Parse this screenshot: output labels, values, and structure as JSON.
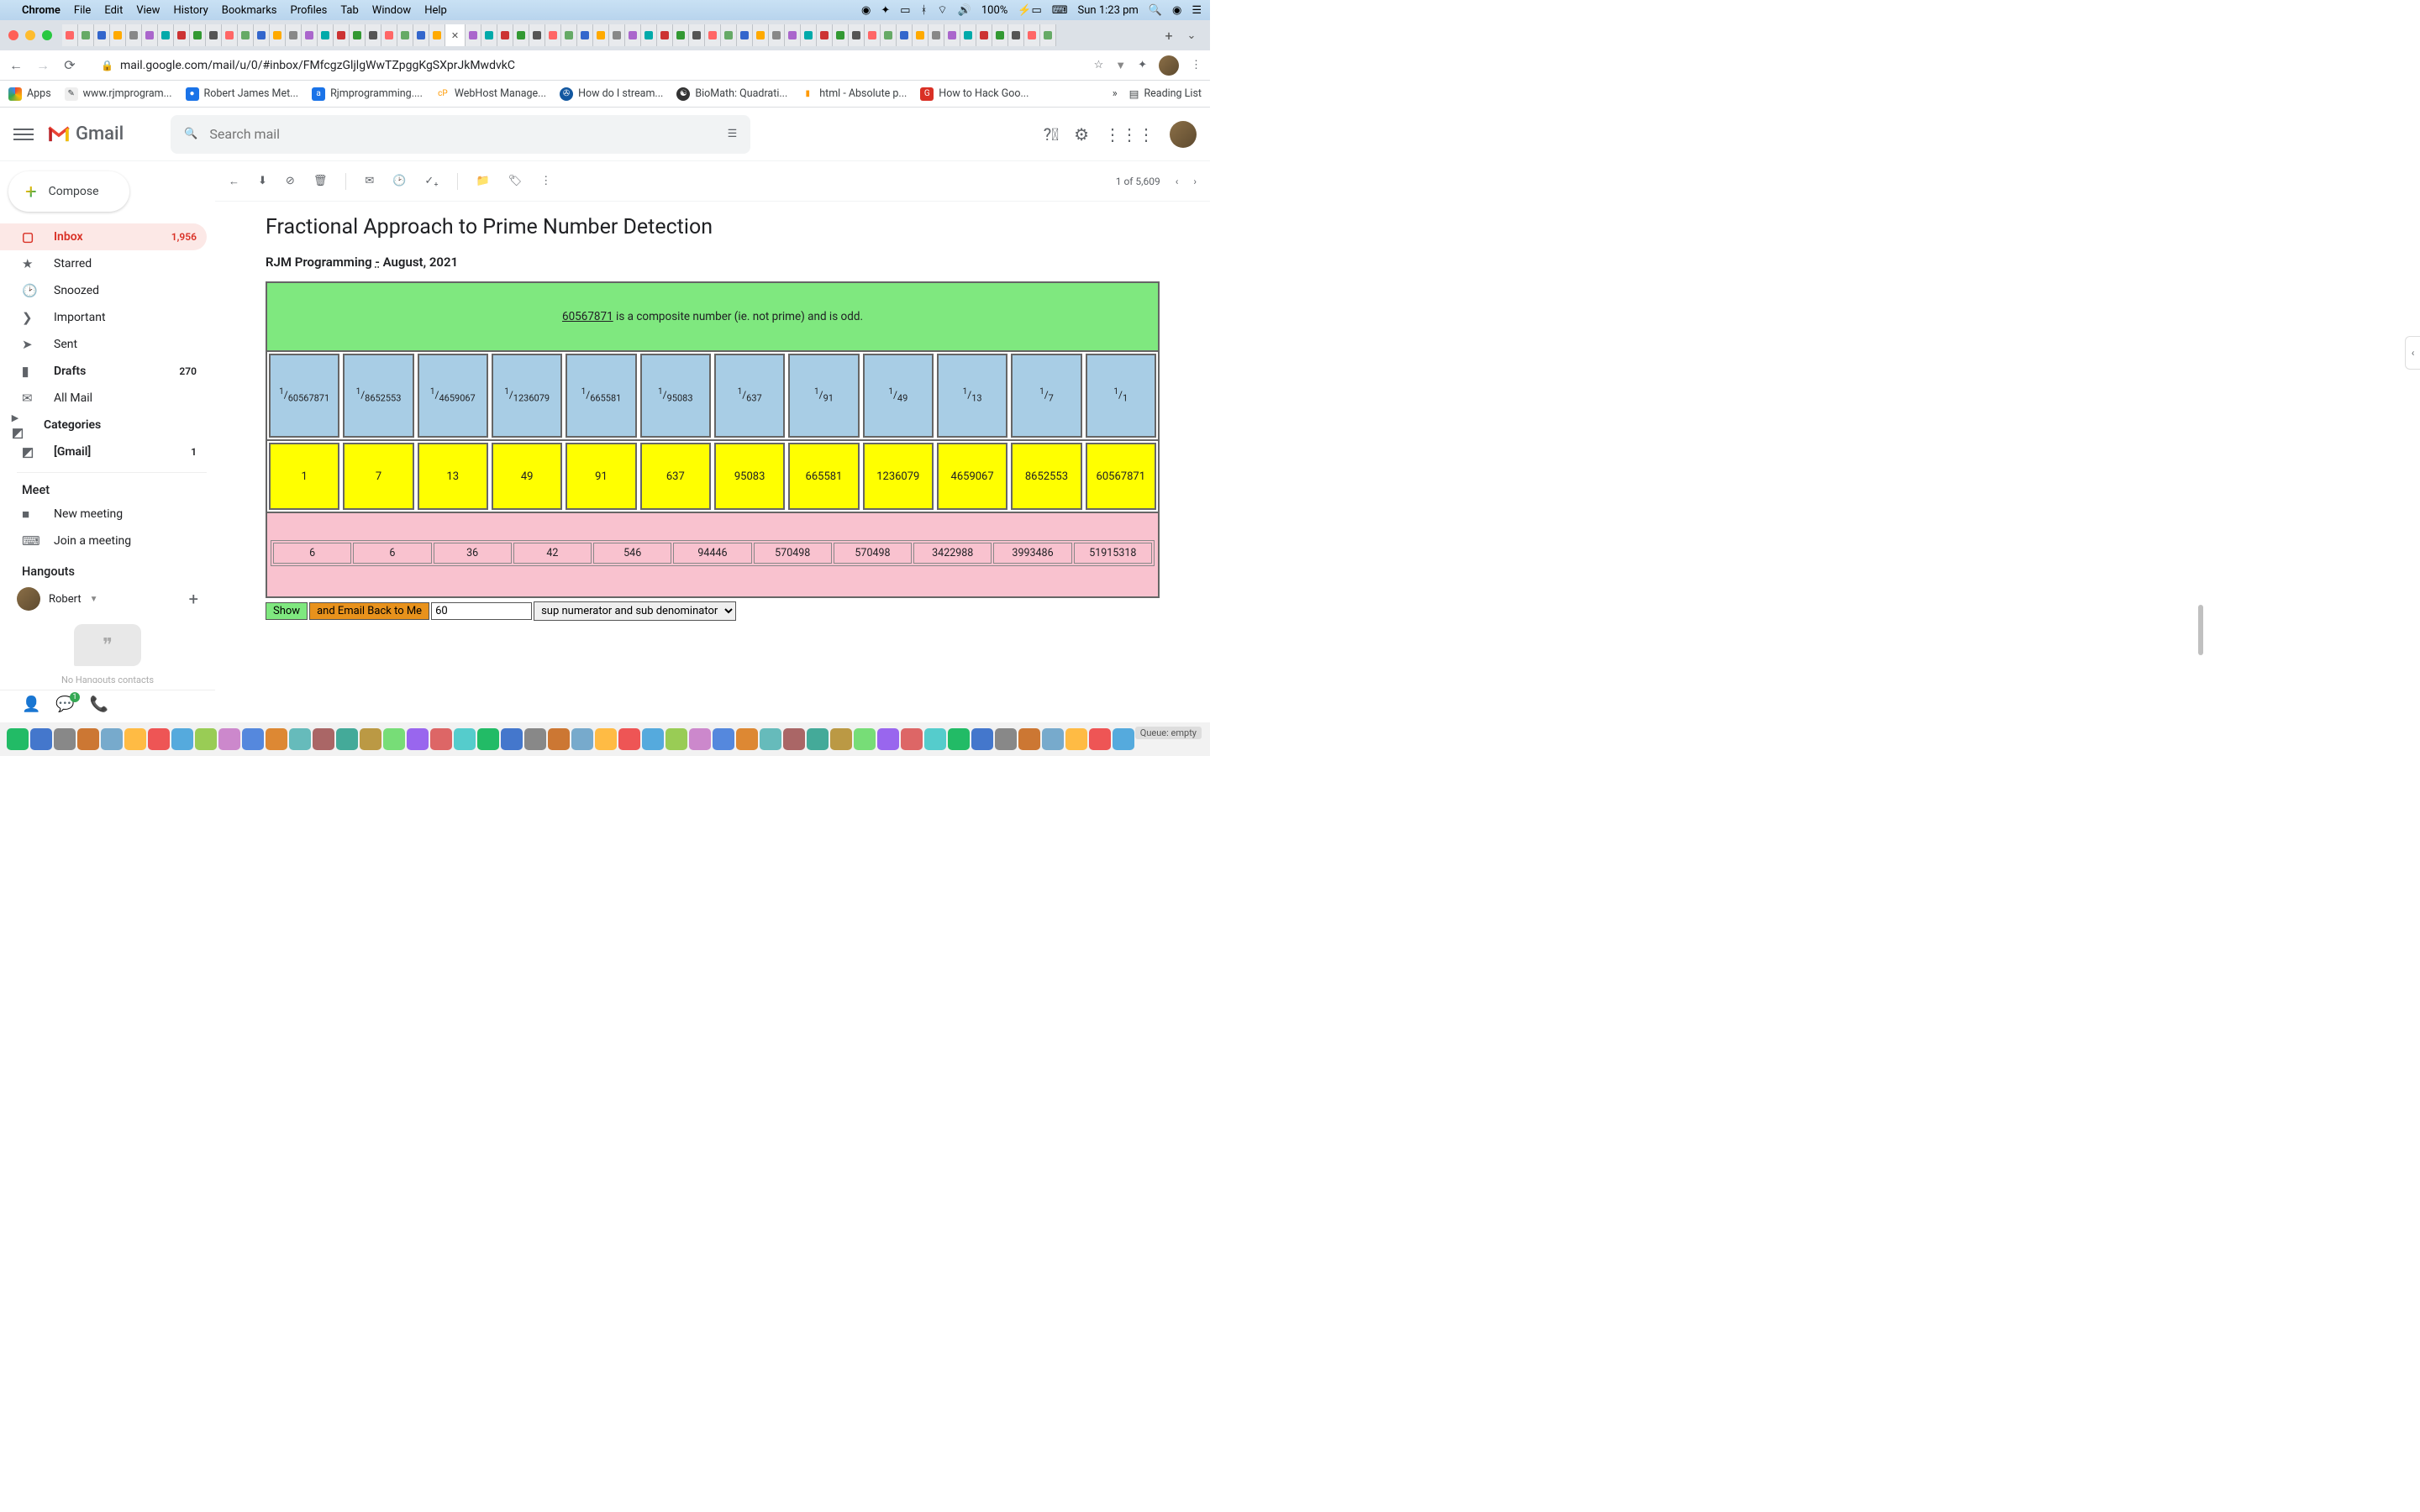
{
  "menubar": {
    "app": "Chrome",
    "items": [
      "File",
      "Edit",
      "View",
      "History",
      "Bookmarks",
      "Profiles",
      "Tab",
      "Window",
      "Help"
    ],
    "battery": "100%",
    "clock": "Sun 1:23 pm"
  },
  "url": "mail.google.com/mail/u/0/#inbox/FMfcgzGljlgWwTZpggKgSXprJkMwdvkC",
  "bookmarks": {
    "apps": "Apps",
    "items": [
      "www.rjmprogram...",
      "Robert James Met...",
      "Rjmprogramming....",
      "WebHost Manage...",
      "How do I stream...",
      "BioMath: Quadrati...",
      "html - Absolute p...",
      "How to Hack Goo..."
    ],
    "overflow": "»",
    "reading": "Reading List"
  },
  "gmail": {
    "brand": "Gmail",
    "search_placeholder": "Search mail",
    "compose": "Compose",
    "paging": "1 of 5,609"
  },
  "sidebar": {
    "items": [
      {
        "label": "Inbox",
        "count": "1,956",
        "active": true
      },
      {
        "label": "Starred"
      },
      {
        "label": "Snoozed"
      },
      {
        "label": "Important"
      },
      {
        "label": "Sent"
      },
      {
        "label": "Drafts",
        "count": "270"
      },
      {
        "label": "All Mail"
      },
      {
        "label": "Categories"
      },
      {
        "label": "[Gmail]",
        "count": "1"
      }
    ],
    "meet_label": "Meet",
    "meet_new": "New meeting",
    "meet_join": "Join a meeting",
    "hangouts_label": "Hangouts",
    "hangouts_user": "Robert",
    "no_contacts": "No Hangouts contacts"
  },
  "mail": {
    "subject": "Fractional Approach to Prime Number Detection",
    "subtitle_prefix": "RJM Programming ",
    "subtitle_dash": "-",
    "subtitle_suffix": " August, 2021"
  },
  "prime": {
    "number": "60567871",
    "result_text": " is a composite number (ie. not prime) and is odd.",
    "fractions": [
      "60567871",
      "8652553",
      "4659067",
      "1236079",
      "665581",
      "95083",
      "637",
      "91",
      "49",
      "13",
      "7",
      "1"
    ],
    "factors": [
      "1",
      "7",
      "13",
      "49",
      "91",
      "637",
      "95083",
      "665581",
      "1236079",
      "4659067",
      "8652553",
      "60567871"
    ],
    "diffs": [
      "6",
      "6",
      "36",
      "42",
      "546",
      "94446",
      "570498",
      "570498",
      "3422988",
      "3993486",
      "51915318"
    ],
    "controls": {
      "show": "Show",
      "email": "and Email Back to Me",
      "input": "60",
      "select": "sup numerator and sub denominator"
    }
  },
  "dock": {
    "status": "Queue: empty"
  }
}
